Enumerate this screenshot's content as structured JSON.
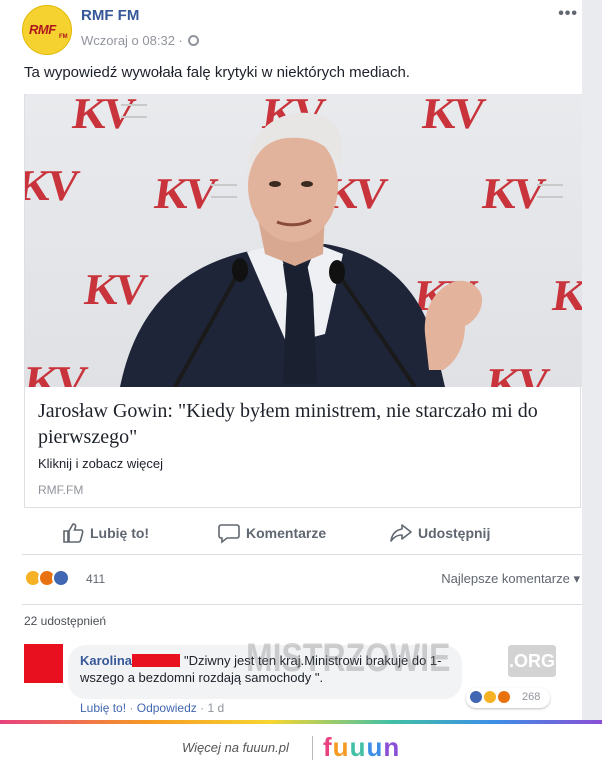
{
  "post": {
    "page_name": "RMF FM",
    "avatar_text": "RMF",
    "avatar_sub": "FM",
    "timestamp": "Wczoraj o 08:32 ·",
    "more_label": "•••",
    "text": "Ta wypowiedź wywołała falę krytyki w niektórych mediach."
  },
  "link_card": {
    "title": "Jarosław Gowin: \"Kiedy byłem ministrem, nie starczało mi do pierwszego\"",
    "description": "Kliknij i zobacz więcej",
    "domain": "RMF.FM",
    "backdrop_logo": "KV"
  },
  "actions": {
    "like": "Lubię to!",
    "comment": "Komentarze",
    "share": "Udostępnij"
  },
  "reactions": {
    "count": "411",
    "sort_label": "Najlepsze komentarze ▾",
    "shares": "22 udostępnień"
  },
  "comment": {
    "author": "Karolina",
    "text": "\"Dziwny jest ten kraj.Ministrowi brakuje do 1-wszego a bezdomni rozdają samochody \".",
    "reaction_count": "268",
    "like_label": "Lubię to!",
    "reply_label": "Odpowiedz",
    "age": "1 d"
  },
  "watermark": {
    "text": "MISTRZOWIE",
    "org": ".ORG"
  },
  "footer": {
    "more_text": "Więcej na fuuun.pl",
    "logo_letters": [
      "f",
      "u",
      "u",
      "u",
      "n"
    ]
  },
  "colors": {
    "link_blue": "#365899",
    "action_gray": "#606770",
    "like_blue": "#4267b2",
    "haha_yellow": "#f7b125",
    "angry_red": "#e9710f",
    "redaction_red": "#e8101e"
  }
}
